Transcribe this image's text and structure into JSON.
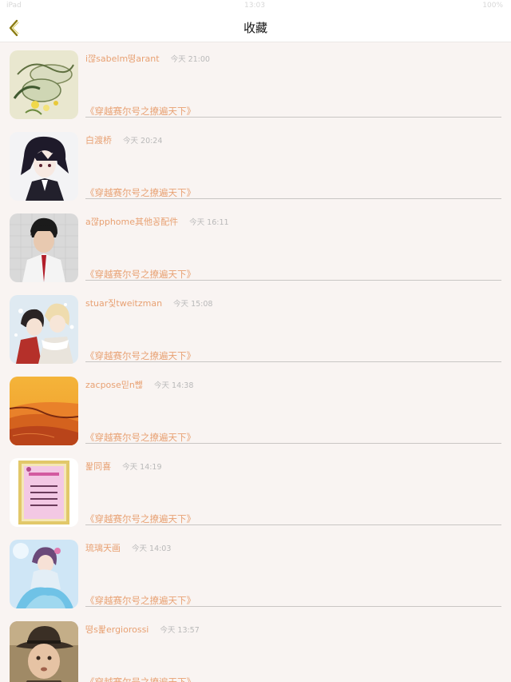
{
  "status_bar": {
    "left": "iPad",
    "center": "13:03",
    "right": "100%"
  },
  "nav": {
    "title": "收藏"
  },
  "favorites": [
    {
      "name": "i꺊sabelm뗭arant",
      "time": "今天 21:00",
      "book": "《穿越赛尔号之撩遍天下》",
      "avatar": "tea-cup-painting"
    },
    {
      "name": "白渡桥",
      "time": "今天 20:24",
      "book": "《穿越赛尔号之撩遍天下》",
      "avatar": "anime-boy"
    },
    {
      "name": "a꺊pphome其他꽁配件",
      "time": "今天 16:11",
      "book": "《穿越赛尔号之撩遍天下》",
      "avatar": "student-photo"
    },
    {
      "name": "stuar짗tweitzman",
      "time": "今天 15:08",
      "book": "《穿越赛尔号之撩遍天下》",
      "avatar": "anime-couple"
    },
    {
      "name": "zacpose믿n뺂",
      "time": "今天 14:38",
      "book": "《穿越赛尔号之撩遍天下》",
      "avatar": "desert-dunes"
    },
    {
      "name": "퐕同喜",
      "time": "今天 14:19",
      "book": "《穿越赛尔号之撩遍天下》",
      "avatar": "framed-poem"
    },
    {
      "name": "琉璃天画",
      "time": "今天 14:03",
      "book": "《穿越赛尔号之撩遍天下》",
      "avatar": "fairy-girl"
    },
    {
      "name": "뗭s퐕ergiorossi",
      "time": "今天 13:57",
      "book": "《穿越赛尔号之撩遍天下》",
      "avatar": "boy-hat"
    }
  ],
  "colors": {
    "accent": "#e8a173",
    "time": "#b9b9b9",
    "background": "#f9f4f2",
    "back_icon": "#8a7a10"
  }
}
